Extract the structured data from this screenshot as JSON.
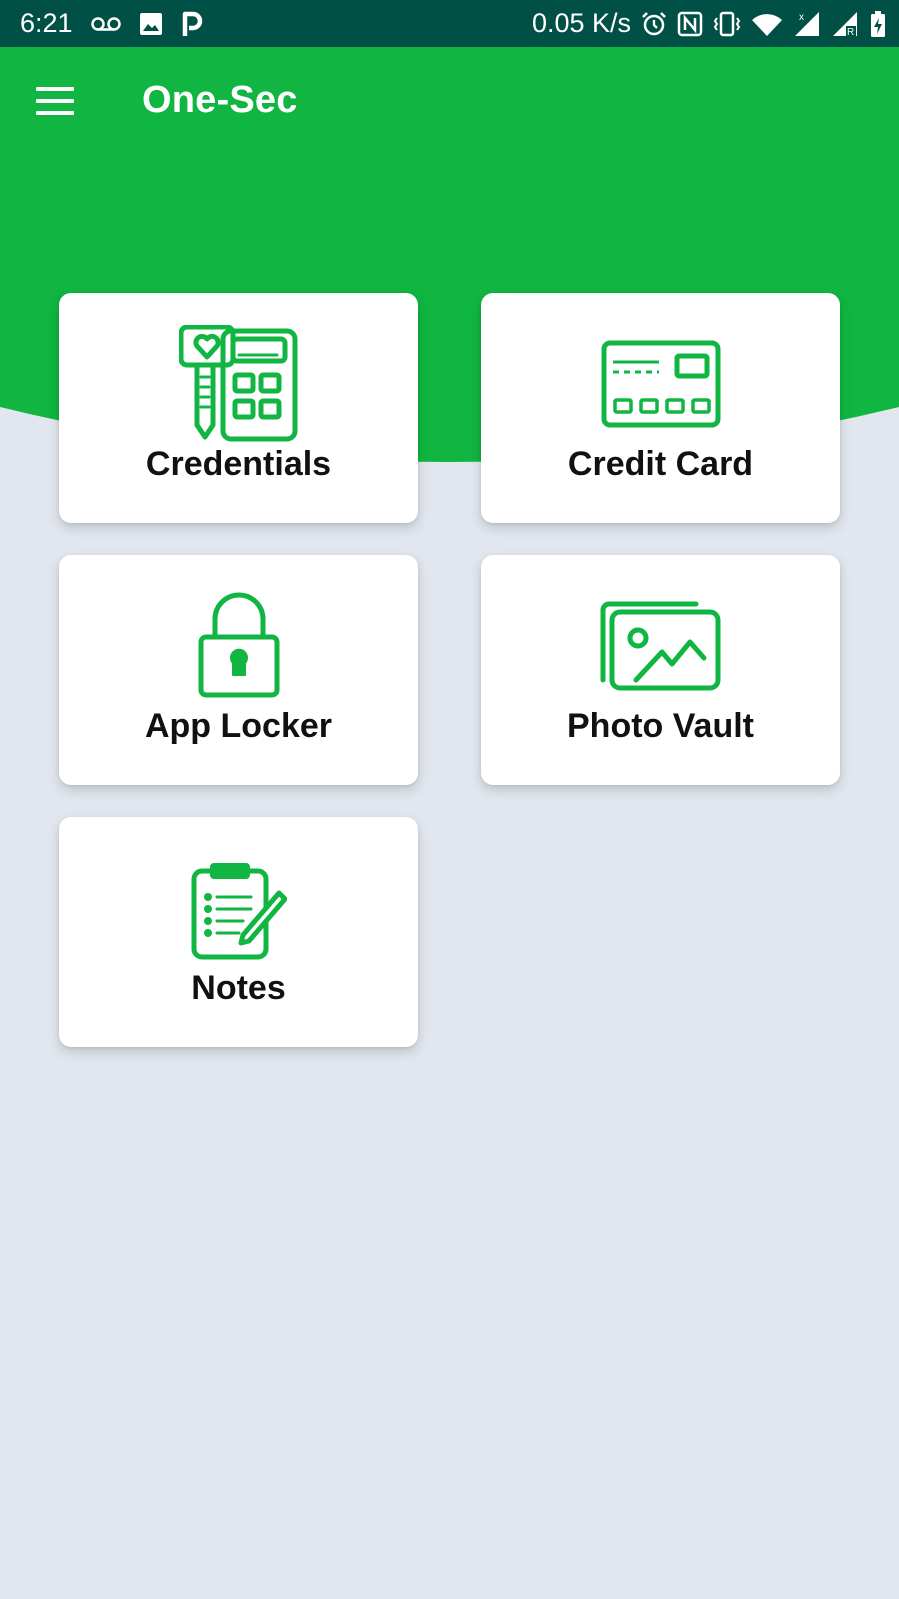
{
  "status_bar": {
    "time": "6:21",
    "network_speed": "0.05 K/s",
    "icons": [
      "voicemail-icon",
      "image-notification-icon",
      "p-app-icon",
      "alarm-icon",
      "nfc-icon",
      "vibrate-icon",
      "wifi-icon",
      "signal-icon",
      "signal-roaming-icon",
      "battery-charging-icon"
    ]
  },
  "toolbar": {
    "title": "One-Sec",
    "menu_icon": "hamburger-menu-icon"
  },
  "colors": {
    "primary": "#10b641",
    "status_bar": "#005046",
    "background": "#e2e7ef",
    "icon_green": "#10b641"
  },
  "cards": [
    {
      "label": "Credentials",
      "icon": "key-keypad-icon"
    },
    {
      "label": "Credit Card",
      "icon": "credit-card-icon"
    },
    {
      "label": "App Locker",
      "icon": "padlock-icon"
    },
    {
      "label": "Photo Vault",
      "icon": "photo-stack-icon"
    },
    {
      "label": "Notes",
      "icon": "clipboard-pencil-icon"
    }
  ]
}
